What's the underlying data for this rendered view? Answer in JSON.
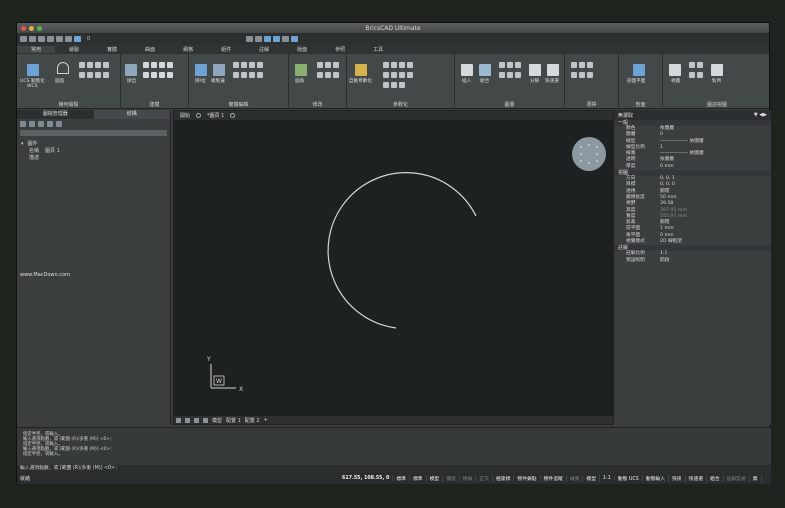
{
  "window": {
    "title": "BricsCAD Ultimate"
  },
  "quick_access": {
    "layer": "0"
  },
  "ribbon": {
    "tabs": [
      "常用",
      "繪製",
      "實體",
      "曲面",
      "網格",
      "組件",
      "註解",
      "版面",
      "參照",
      "工具"
    ],
    "active_tab": 0,
    "groups": [
      "幾何繪製",
      "建模",
      "實體編輯",
      "修改",
      "參數化",
      "圖層",
      "選擇",
      "剖面",
      "圖訓視圖"
    ],
    "buttons": {
      "ucs": "UCS 動態化",
      "wcs": "WCS",
      "arc": "圓弧",
      "extrude": "擠出",
      "press": "擠/拉",
      "solidedit": "複製邊",
      "fillet": "圓角",
      "param": "自動參數化",
      "insert": "插入",
      "group": "組合",
      "explode": "分解",
      "quicksel": "快速選",
      "section": "剖面平面",
      "view": "視圖",
      "align": "對齊"
    }
  },
  "left_panel": {
    "tabs": [
      "圖檔管理器",
      "結構"
    ],
    "section": "圖件",
    "rows": [
      {
        "k": "名稱",
        "v": "圖頁 1"
      },
      {
        "k": "描述",
        "v": ""
      }
    ],
    "watermark": "www.MacDown.com"
  },
  "canvas": {
    "tabs": [
      "開始",
      "*圖頁 1"
    ],
    "ucs_label": "W",
    "axis_x": "X",
    "axis_y": "Y",
    "layouts": [
      "模型",
      "配置 1",
      "配置 2",
      "+"
    ]
  },
  "properties": {
    "header": "無選取",
    "sections": [
      {
        "title": "一般",
        "rows": [
          {
            "k": "顏色",
            "v": "依圖層"
          },
          {
            "k": "圖層",
            "v": "0"
          },
          {
            "k": "線型",
            "v": "—————— 依圖層"
          },
          {
            "k": "線型比例",
            "v": "1"
          },
          {
            "k": "線寬",
            "v": "—————— 依圖層"
          },
          {
            "k": "透明",
            "v": "依圖層"
          },
          {
            "k": "厚度",
            "v": "0 mm"
          }
        ]
      },
      {
        "title": "視圖",
        "rows": [
          {
            "k": "方向",
            "v": "0, 0, 1"
          },
          {
            "k": "目標",
            "v": "0, 0, 0"
          },
          {
            "k": "透視",
            "v": "關閉"
          },
          {
            "k": "鏡頭長度",
            "v": "50 mm"
          },
          {
            "k": "視野",
            "v": "39.58"
          },
          {
            "k": "高度",
            "v": "397.05 mm",
            "dim": true
          },
          {
            "k": "寬度",
            "v": "555.97 mm",
            "dim": true
          },
          {
            "k": "剪裁",
            "v": "關閉"
          },
          {
            "k": "前平面",
            "v": "1 mm"
          },
          {
            "k": "後平面",
            "v": "0 mm"
          },
          {
            "k": "視覺樣式",
            "v": "2D 線框架"
          }
        ]
      },
      {
        "title": "註解",
        "rows": [
          {
            "k": "註解比例",
            "v": "1:1"
          },
          {
            "k": "預設照明",
            "v": "開啟"
          }
        ]
      }
    ]
  },
  "command": {
    "history": [
      "指定半徑，或輸入。",
      "輸入選項點數，或 [範圍 (R)/多重 (M)] <0>：",
      "指定半徑，或輸入。",
      "輸入選項點數，或 [範圍 (R)/多重 (M)] <0>：",
      "指定半徑，或輸入。"
    ],
    "prompt": "輸入選項點數，或 [範圍 (R)/多重 (M)] <0>："
  },
  "status": {
    "left": "就緒",
    "coords": "617.55, 108.55, 0",
    "buttons": [
      {
        "label": "標準",
        "on": true
      },
      {
        "label": "標準",
        "on": true
      },
      {
        "label": "模型",
        "on": true
      },
      {
        "label": "捕捉",
        "on": false
      },
      {
        "label": "格線",
        "on": false
      },
      {
        "label": "正交",
        "on": false
      },
      {
        "label": "極座標",
        "on": true
      },
      {
        "label": "物件鎖點",
        "on": true
      },
      {
        "label": "物件追蹤",
        "on": true
      },
      {
        "label": "線寬",
        "on": false
      },
      {
        "label": "模型",
        "on": true
      },
      {
        "label": "1:1",
        "on": true
      },
      {
        "label": "動態 UCS",
        "on": true
      },
      {
        "label": "動態輸入",
        "on": true
      },
      {
        "label": "快訊",
        "on": true
      },
      {
        "label": "快速選",
        "on": true
      },
      {
        "label": "組合",
        "on": true
      },
      {
        "label": "註解監視",
        "on": false
      },
      {
        "label": "無",
        "on": true
      }
    ]
  },
  "colors": {
    "accent": "#6fa3d6",
    "canvas_bg": "#1d2122",
    "panel_bg": "#3a3e3e"
  }
}
